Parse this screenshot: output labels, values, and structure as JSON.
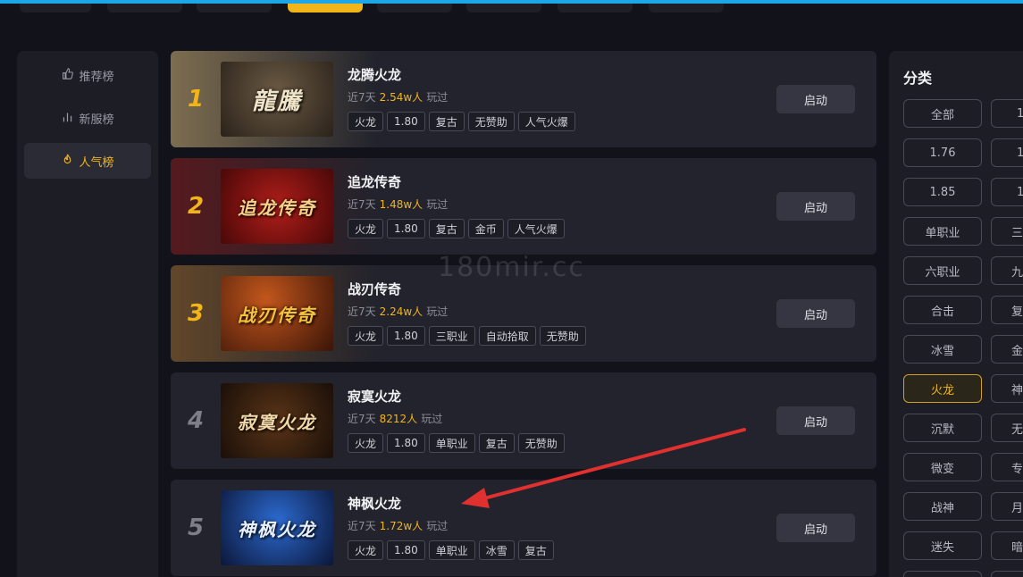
{
  "sidebar": {
    "items": [
      {
        "label": "推荐榜",
        "icon": "thumbs-up-icon",
        "glyph": "👍"
      },
      {
        "label": "新服榜",
        "icon": "bar-chart-icon",
        "glyph": "ılı"
      },
      {
        "label": "人气榜",
        "icon": "flame-icon",
        "glyph": "♨"
      }
    ]
  },
  "watermark": "180mir.cc",
  "games": [
    {
      "rank": "1",
      "name": "龙腾火龙",
      "recent": "近7天",
      "count": "2.54w人",
      "played": "玩过",
      "thumb_text": "龍騰",
      "tags": [
        "火龙",
        "1.80",
        "复古",
        "无赞助",
        "人气火爆"
      ],
      "launch": "启动"
    },
    {
      "rank": "2",
      "name": "追龙传奇",
      "recent": "近7天",
      "count": "1.48w人",
      "played": "玩过",
      "thumb_text": "追龙传奇",
      "tags": [
        "火龙",
        "1.80",
        "复古",
        "金币",
        "人气火爆"
      ],
      "launch": "启动"
    },
    {
      "rank": "3",
      "name": "战刃传奇",
      "recent": "近7天",
      "count": "2.24w人",
      "played": "玩过",
      "thumb_text": "战刃传奇",
      "tags": [
        "火龙",
        "1.80",
        "三职业",
        "自动拾取",
        "无赞助"
      ],
      "launch": "启动"
    },
    {
      "rank": "4",
      "name": "寂寞火龙",
      "recent": "近7天",
      "count": "8212人",
      "played": "玩过",
      "thumb_text": "寂寞火龙",
      "tags": [
        "火龙",
        "1.80",
        "单职业",
        "复古",
        "无赞助"
      ],
      "launch": "启动"
    },
    {
      "rank": "5",
      "name": "神枫火龙",
      "recent": "近7天",
      "count": "1.72w人",
      "played": "玩过",
      "thumb_text": "神枫火龙",
      "tags": [
        "火龙",
        "1.80",
        "单职业",
        "冰雪",
        "复古"
      ],
      "launch": "启动"
    }
  ],
  "categories": {
    "title": "分类",
    "col1": [
      "全部",
      "1.76",
      "1.85",
      "单职业",
      "六职业",
      "合击",
      "冰雪",
      "火龙",
      "沉默",
      "微变",
      "战神",
      "迷失"
    ],
    "col2": [
      "1",
      "1",
      "1",
      "三",
      "九",
      "复",
      "金",
      "神",
      "无",
      "专",
      "月",
      "暗"
    ],
    "selected": "火龙"
  },
  "colors": {
    "accent": "#f1b51a",
    "top_line": "#1ea7e6",
    "arrow": "#e03030"
  }
}
